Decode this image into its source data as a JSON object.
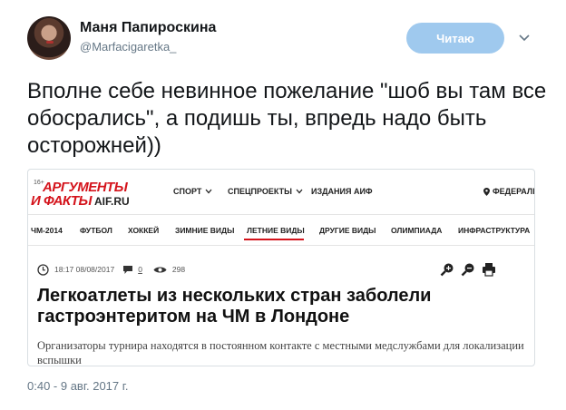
{
  "tweet": {
    "display_name": "Маня Папироскина",
    "handle": "@Marfacigaretka_",
    "follow_label": "Читаю",
    "text": "Вполне себе невинное пожелание \"шоб вы там все обосрались\", а подишь ты, впредь надо быть осторожней))",
    "timestamp": "0:40 - 9 авг. 2017 г.",
    "follow_button_color": "#9fc9ee"
  },
  "card": {
    "logo": {
      "age": "16+",
      "line1": "АРГУМЕНТЫ",
      "line2": "И ФАКТЫ",
      "site": "AIF.RU",
      "brand_color": "#d4131b"
    },
    "top_nav": [
      "СПОРТ",
      "СПЕЦПРОЕКТЫ",
      "ИЗДАНИЯ АИФ"
    ],
    "region": "ФЕДЕРАЛЬ",
    "sub_nav": [
      "ЧМ-2014",
      "ФУТБОЛ",
      "ХОККЕЙ",
      "ЗИМНИЕ ВИДЫ",
      "ЛЕТНИЕ ВИДЫ",
      "ДРУГИЕ ВИДЫ",
      "ОЛИМПИАДА",
      "ИНФРАСТРУКТУРА"
    ],
    "active_sub_nav": "ЛЕТНИЕ ВИДЫ",
    "meta": {
      "datetime": "18:17 08/08/2017",
      "comments": "0",
      "views": "298"
    },
    "article_title": "Легкоатлеты из нескольких стран заболели гастроэнтеритом на ЧМ в Лондоне",
    "article_lead": "Организаторы турнира находятся в постоянном контакте с местными медслужбами для локализации вспышки",
    "icons": [
      "clock-icon",
      "comment-icon",
      "eye-icon",
      "zoom-in-icon",
      "zoom-out-icon",
      "print-icon"
    ]
  }
}
